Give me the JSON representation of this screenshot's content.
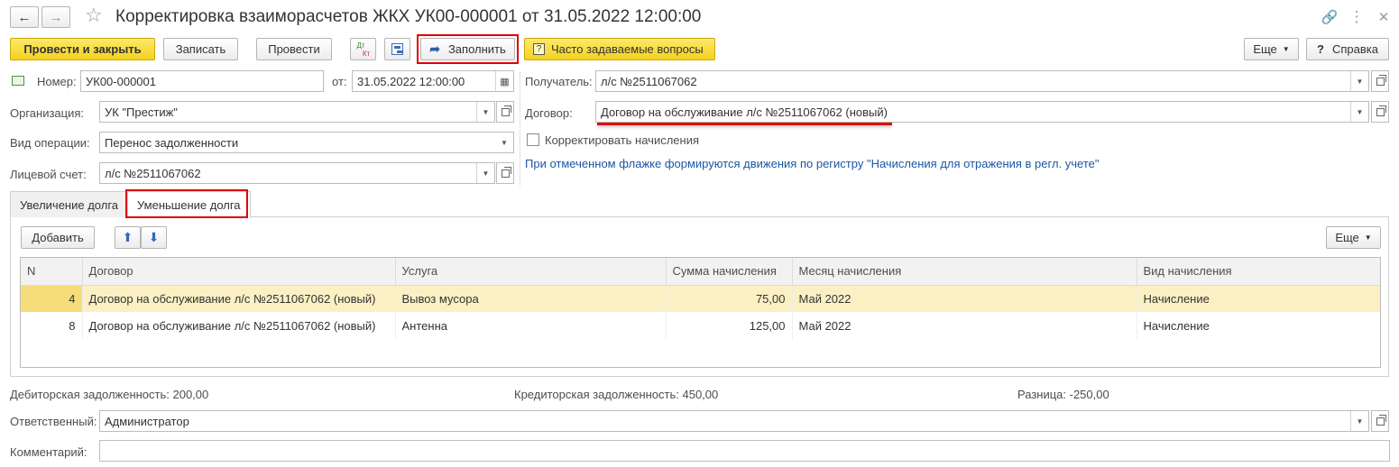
{
  "window": {
    "title": "Корректировка взаиморасчетов ЖКХ УК00-000001 от 31.05.2022 12:00:00"
  },
  "toolbar": {
    "post_close": "Провести и закрыть",
    "write": "Записать",
    "post": "Провести",
    "dtkt_top": "Дт",
    "dtkt_bottom": "Кт",
    "fill": "Заполнить",
    "faq": "Часто задаваемые вопросы",
    "more": "Еще",
    "help": "Справка",
    "help_icon": "?"
  },
  "form": {
    "number_label": "Номер:",
    "number_value": "УК00-000001",
    "date_label": "от:",
    "date_value": "31.05.2022 12:00:00",
    "org_label": "Организация:",
    "org_value": "УК \"Престиж\"",
    "op_label": "Вид операции:",
    "op_value": "Перенос задолженности",
    "account_label": "Лицевой счет:",
    "account_value": "л/с №2511067062",
    "recipient_label": "Получатель:",
    "recipient_value": "л/с №2511067062",
    "contract_label": "Договор:",
    "contract_value": "Договор на обслуживание л/с №2511067062 (новый)",
    "adjust_label": "Корректировать начисления",
    "info_text": "При отмеченном флажке формируются движения по регистру \"Начисления для отражения в регл. учете\""
  },
  "tabs": [
    {
      "label": "Увеличение долга"
    },
    {
      "label": "Уменьшение долга"
    }
  ],
  "table_toolbar": {
    "add": "Добавить",
    "more": "Еще"
  },
  "table": {
    "columns": [
      "N",
      "Договор",
      "Услуга",
      "Сумма начисления",
      "Месяц начисления",
      "Вид начисления"
    ],
    "rows": [
      {
        "n": "4",
        "contract": "Договор на обслуживание л/с №2511067062 (новый)",
        "service": "Вывоз мусора",
        "sum": "75,00",
        "month": "Май 2022",
        "kind": "Начисление"
      },
      {
        "n": "8",
        "contract": "Договор на обслуживание л/с №2511067062 (новый)",
        "service": "Антенна",
        "sum": "125,00",
        "month": "Май 2022",
        "kind": "Начисление"
      }
    ]
  },
  "totals": {
    "debit": "Дебиторская задолженность: 200,00",
    "credit": "Кредиторская задолженность: 450,00",
    "diff": "Разница: -250,00"
  },
  "footer": {
    "responsible_label": "Ответственный:",
    "responsible_value": "Администратор",
    "comment_label": "Комментарий:",
    "comment_value": ""
  },
  "icons": {
    "back": "arrow-left-icon",
    "forward": "arrow-right-icon",
    "favorite": "star-icon",
    "link": "link-icon",
    "menu": "vertical-dots-icon",
    "close": "close-icon"
  },
  "colors": {
    "accent_yellow": "#f4d21d",
    "highlight_red": "#e00000",
    "selected_row": "#fbf0c3",
    "info_blue": "#1a56a6"
  }
}
